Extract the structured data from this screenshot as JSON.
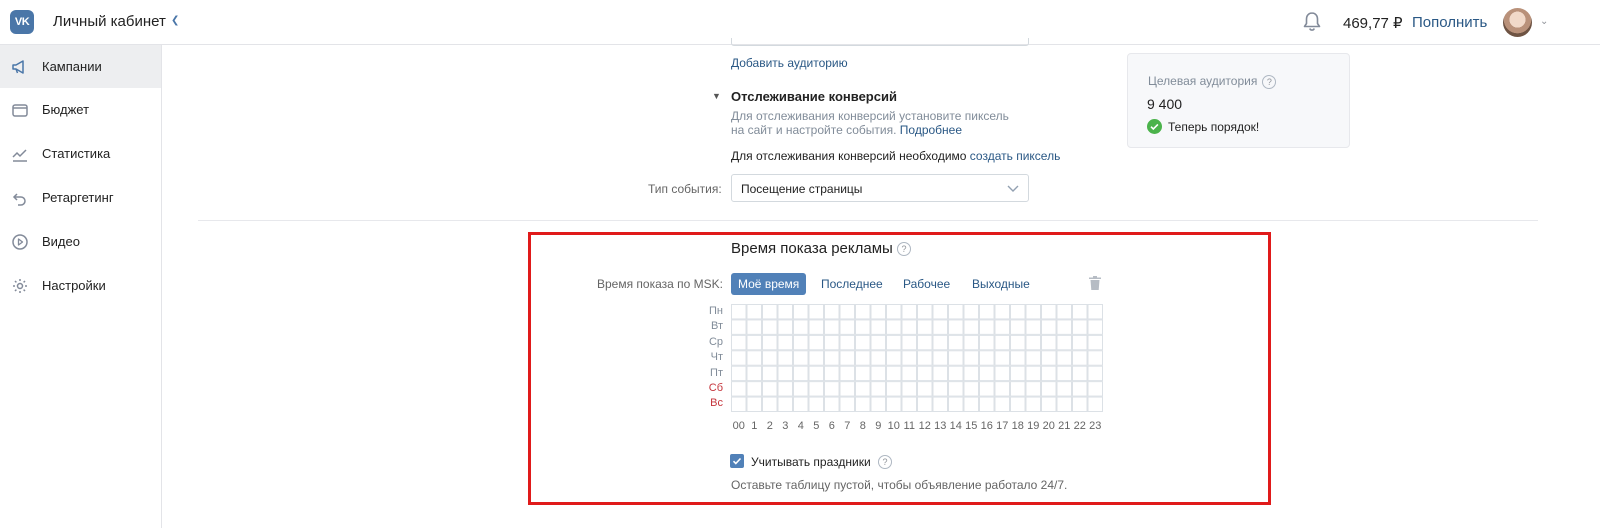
{
  "header": {
    "logo": "VK",
    "cabinet_title": "Личный кабинет",
    "balance": "469,77 ₽",
    "topup_label": "Пополнить"
  },
  "sidebar": {
    "items": [
      {
        "label": "Кампании",
        "icon": "megaphone-icon",
        "active": true
      },
      {
        "label": "Бюджет",
        "icon": "wallet-icon",
        "active": false
      },
      {
        "label": "Статистика",
        "icon": "chart-icon",
        "active": false
      },
      {
        "label": "Ретаргетинг",
        "icon": "retarget-icon",
        "active": false
      },
      {
        "label": "Видео",
        "icon": "play-icon",
        "active": false
      },
      {
        "label": "Настройки",
        "icon": "gear-icon",
        "active": false
      }
    ]
  },
  "targeting": {
    "add_audience": "Добавить аудиторию"
  },
  "conversions": {
    "title": "Отслеживание конверсий",
    "desc_line1": "Для отслеживания конверсий установите пиксель",
    "desc_line2": "на сайт и настройте события.",
    "more_link": "Подробнее",
    "need_text": "Для отслеживания конверсий необходимо",
    "create_pixel_link": "создать пиксель",
    "event_label": "Тип события:",
    "event_value": "Посещение страницы"
  },
  "audience_card": {
    "title": "Целевая аудитория",
    "value": "9 400",
    "status": "Теперь порядок!"
  },
  "schedule": {
    "title": "Время показа рекламы",
    "msk_label": "Время показа по MSK:",
    "presets": [
      "Моё время",
      "Последнее",
      "Рабочее",
      "Выходные"
    ],
    "active_preset": "Моё время",
    "days": [
      "Пн",
      "Вт",
      "Ср",
      "Чт",
      "Пт",
      "Сб",
      "Вс"
    ],
    "hours": [
      "00",
      "1",
      "2",
      "3",
      "4",
      "5",
      "6",
      "7",
      "8",
      "9",
      "10",
      "11",
      "12",
      "13",
      "14",
      "15",
      "16",
      "17",
      "18",
      "19",
      "20",
      "21",
      "22",
      "23"
    ],
    "holidays_label": "Учитывать праздники",
    "holidays_checked": true,
    "hint": "Оставьте таблицу пустой, чтобы объявление работало 24/7."
  },
  "colors": {
    "accent": "#5181b8",
    "link": "#2a5885",
    "highlight": "#e01a1a",
    "weekend": "#c5353c",
    "success": "#4bb34b"
  }
}
